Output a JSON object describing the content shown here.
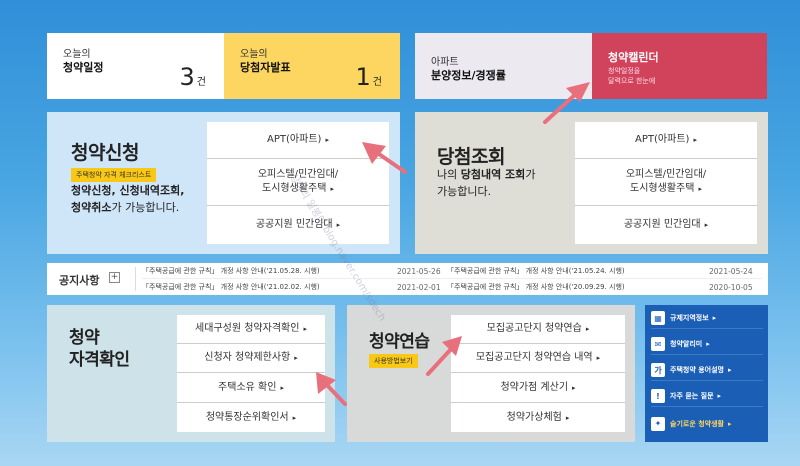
{
  "top": {
    "today_schedule": {
      "small": "오늘의",
      "big": "청약일정",
      "count": "3",
      "unit": "건"
    },
    "today_winner": {
      "small": "오늘의",
      "big": "당첨자발표",
      "count": "1",
      "unit": "건"
    },
    "apt_info": {
      "small": "아파트",
      "big": "분양정보/경쟁률"
    },
    "calendar": {
      "title": "청약캘린더",
      "sub1": "청약일정을",
      "sub2": "달력으로 한눈에"
    }
  },
  "apply": {
    "title": "청약신청",
    "badge": "주택청약 자격 체크리스트",
    "desc_line1_bold": "청약신청, 신청내역조회,",
    "desc_line2_bold": "청약취소",
    "desc_line2_rest": "가 가능합니다.",
    "menu": [
      "APT(아파트)",
      "오피스텔/민간임대/",
      "도시형생활주택",
      "공공지원 민간임대"
    ]
  },
  "result": {
    "title": "당첨조회",
    "desc_line1_pre": "나의 ",
    "desc_line1_bold": "당첨내역 조회",
    "desc_line1_post": "가",
    "desc_line2": "가능합니다.",
    "menu": [
      "APT(아파트)",
      "오피스텔/민간임대/",
      "도시형생활주택",
      "공공지원 민간임대"
    ]
  },
  "notice": {
    "title": "공지사항",
    "plus": "+",
    "items": [
      {
        "text": "「주택공급에 관한 규칙」 개정 사항 안내('21.05.28. 시행)",
        "date": "2021-05-26"
      },
      {
        "text": "「주택공급에 관한 규칙」 개정 사항 안내('21.05.24. 시행)",
        "date": "2021-05-24"
      },
      {
        "text": "「주택공급에 관한 규칙」 개정 사항 안내('21.02.02. 시행)",
        "date": "2021-02-01"
      },
      {
        "text": "「주택공급에 관한 규칙」 개정 사항 안내('20.09.29. 시행)",
        "date": "2020-10-05"
      }
    ]
  },
  "qualification": {
    "title1": "청약",
    "title2": "자격확인",
    "menu": [
      "세대구성원 청약자격확인",
      "신청자 청약제한사항",
      "주택소유 확인",
      "청약통장순위확인서"
    ]
  },
  "practice": {
    "title": "청약연습",
    "badge": "사용방법보기",
    "menu": [
      "모집공고단지 청약연습",
      "모집공고단지 청약연습 내역",
      "청약가점 계산기",
      "청약가상체험"
    ]
  },
  "side": {
    "items": [
      {
        "icon": "building-icon",
        "glyph": "▦",
        "label": "규제지역정보"
      },
      {
        "icon": "mail-icon",
        "glyph": "✉",
        "label": "청약알리미"
      },
      {
        "icon": "ga-icon",
        "glyph": "가",
        "label": "주택청약 용어설명"
      },
      {
        "icon": "exclamation-icon",
        "glyph": "!",
        "label": "자주 묻는 질문"
      },
      {
        "icon": "bulb-icon",
        "glyph": "✦",
        "label": "슬기로운 청약생활"
      }
    ]
  },
  "watermark": "상아리 일봉이 blog.naver.com/sdech",
  "arrow_char": "▸",
  "colors": {
    "arrow": "#e8707c",
    "calendar": "#d0435b",
    "side": "#1b5eb6",
    "yellow": "#fcd660"
  }
}
